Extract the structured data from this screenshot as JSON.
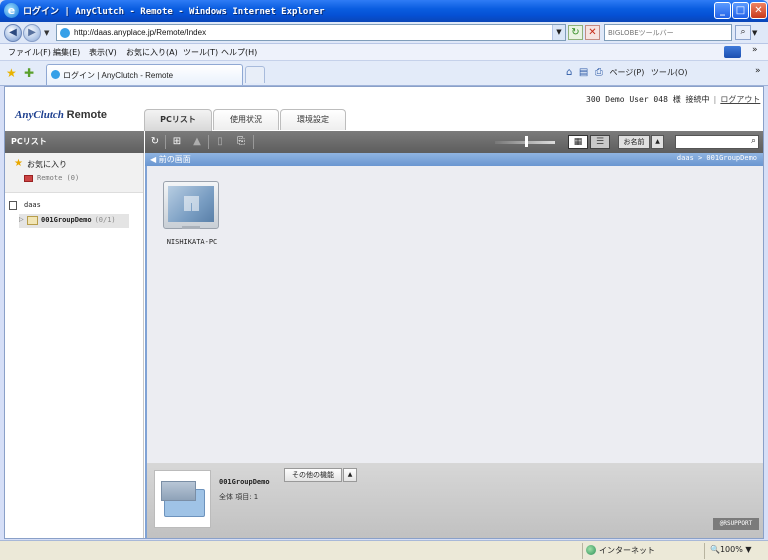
{
  "window": {
    "title": "ログイン | AnyClutch - Remote - Windows Internet Explorer"
  },
  "address": {
    "url": "http://daas.anyplace.jp/Remote/Index",
    "search_placeholder": "BIGLOBEツールバー"
  },
  "menu": {
    "items": [
      "ファイル(F)",
      "編集(E)",
      "表示(V)",
      "お気に入り(A)",
      "ツール(T)",
      "ヘルプ(H)"
    ]
  },
  "browser_tab": {
    "label": "ログイン | AnyClutch - Remote"
  },
  "command_bar": {
    "page_label": "ページ(P)",
    "tools_label": "ツール(O)"
  },
  "app": {
    "brand_name": "AnyClutch",
    "brand_suffix": "Remote",
    "user_text": "300 Demo User 048 様",
    "status_text": "接続中",
    "logout_label": "ログアウト",
    "tabs": [
      {
        "label": "PCリスト",
        "active": true
      },
      {
        "label": "使用状況",
        "active": false
      },
      {
        "label": "環境設定",
        "active": false
      }
    ]
  },
  "sidebar": {
    "header": "PCリスト",
    "favorites_title": "お気に入り",
    "favorites_items": [
      {
        "label": "Remote",
        "count": "(0)"
      }
    ],
    "tree_root": "daas",
    "tree_group": {
      "label": "001GroupDemo",
      "count": "(0/1)"
    }
  },
  "toolbar": {
    "sort_label": "お名前",
    "sort_dir": "▲",
    "search_value": "",
    "zoom_level": 0.5
  },
  "nav": {
    "back_label": "前の画面",
    "breadcrumb": "daas > 001GroupDemo"
  },
  "pcs": [
    {
      "name": "NISHIKATA-PC"
    }
  ],
  "info_panel": {
    "group_name": "001GroupDemo",
    "count_text": "全体 項目: 1",
    "other_functions_label": "その他の機能",
    "dropdown_arrow": "▲",
    "support_label": "@RSUPPORT"
  },
  "statusbar": {
    "zone": "インターネット",
    "zoom": "100%"
  },
  "colors": {
    "ie_title": "#0550d4",
    "nav_strip": "#6a96d1",
    "toolbar_gray": "#6b6b6b",
    "content_bg": "#ecedf2"
  }
}
